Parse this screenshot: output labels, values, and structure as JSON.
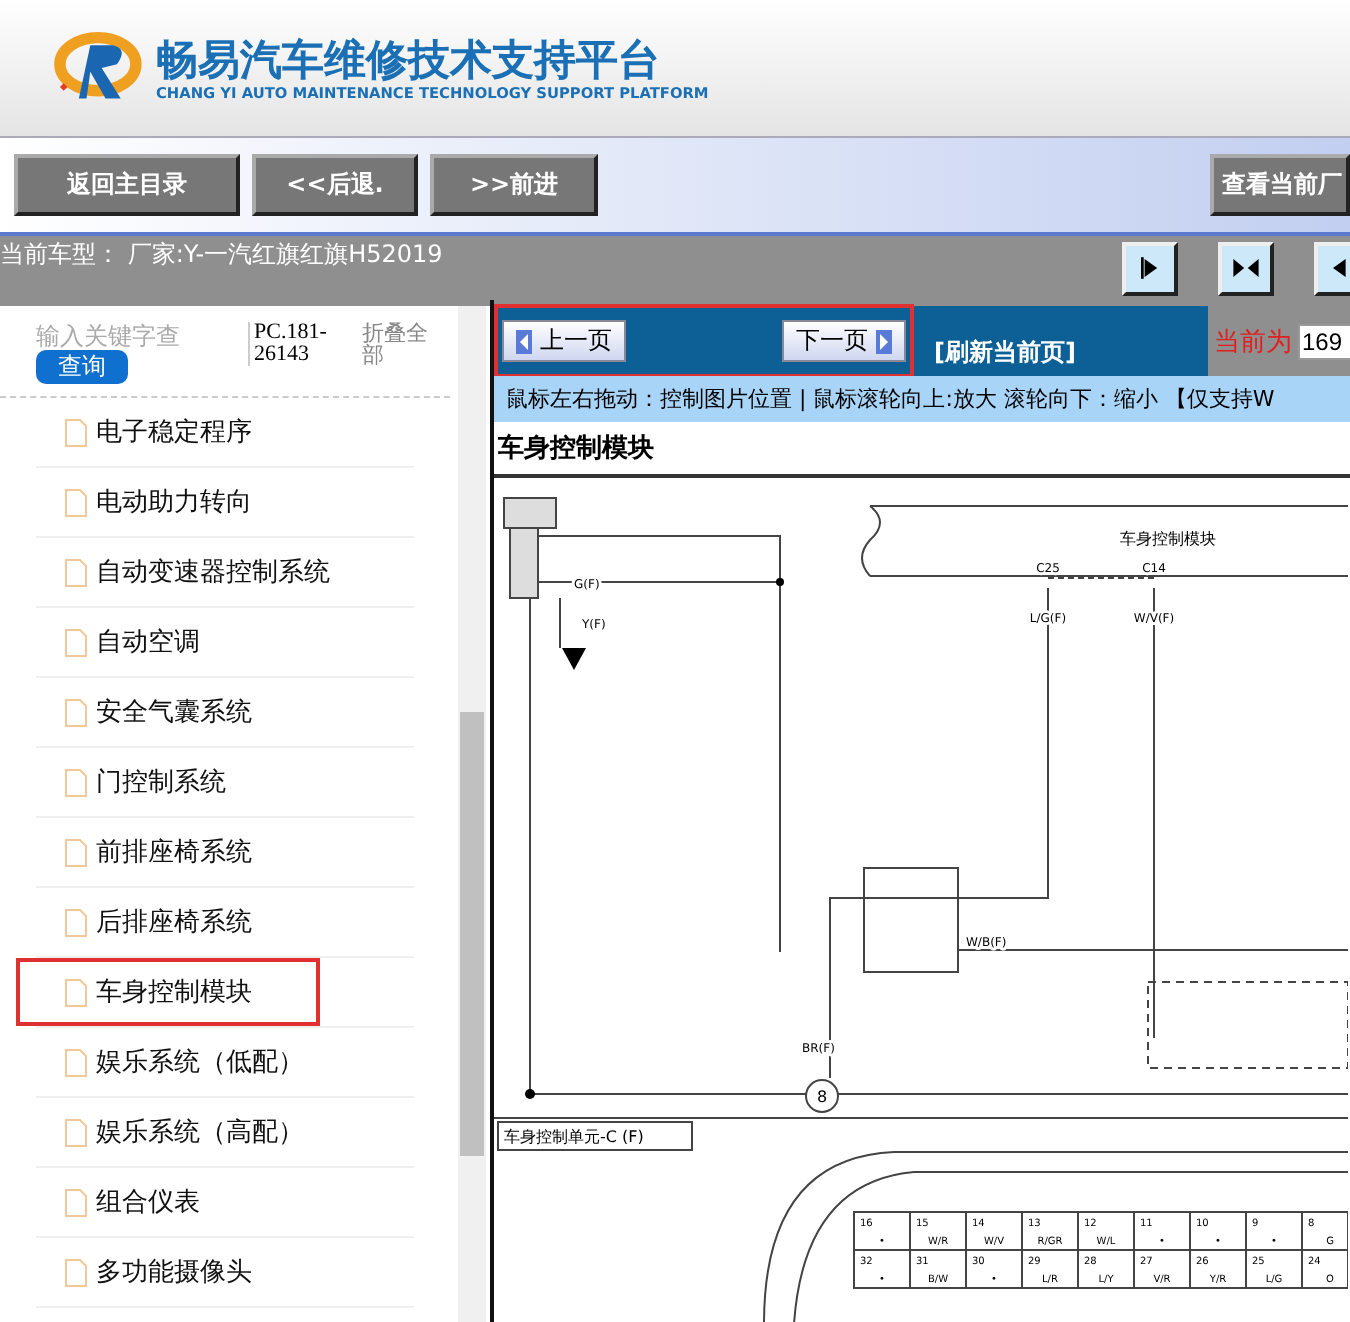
{
  "header": {
    "title": "畅易汽车维修技术支持平台",
    "subtitle": "CHANG YI AUTO MAINTENANCE TECHNOLOGY SUPPORT PLATFORM"
  },
  "toolbar": {
    "buttons": [
      "返回主目录",
      "<<后退.",
      ">>前进"
    ],
    "right_button": "查看当前厂"
  },
  "model_bar": {
    "text": "当前车型： 厂家:Y-一汽红旗红旗H52019"
  },
  "sidebar": {
    "search": {
      "placeholder": "输入关键字查"
    },
    "search_button": "查询",
    "code": "PC.181-26143",
    "collapse": "折叠全部",
    "items": [
      {
        "label": "电子稳定程序",
        "highlighted": false
      },
      {
        "label": "电动助力转向",
        "highlighted": false
      },
      {
        "label": "自动变速器控制系统",
        "highlighted": false
      },
      {
        "label": "自动空调",
        "highlighted": false
      },
      {
        "label": "安全气囊系统",
        "highlighted": false
      },
      {
        "label": "门控制系统",
        "highlighted": false
      },
      {
        "label": "前排座椅系统",
        "highlighted": false
      },
      {
        "label": "后排座椅系统",
        "highlighted": false
      },
      {
        "label": "车身控制模块",
        "highlighted": true
      },
      {
        "label": "娱乐系统（低配）",
        "highlighted": false
      },
      {
        "label": "娱乐系统（高配）",
        "highlighted": false
      },
      {
        "label": "组合仪表",
        "highlighted": false
      },
      {
        "label": "多功能摄像头",
        "highlighted": false
      }
    ]
  },
  "pager": {
    "prev": "上一页",
    "next": "下一页",
    "highlighted": true,
    "refresh": "[刷新当前页]",
    "current_label": "当前为",
    "current_value": "169"
  },
  "hint": "鼠标左右拖动：控制图片位置 | 鼠标滚轮向上:放大  滚轮向下：缩小 【仅支持W",
  "page_title": "车身控制模块",
  "diagram": {
    "module": "车身控制模块",
    "connector_a": "C25",
    "connector_b": "C14",
    "wire_a": "L/G(F)",
    "wire_b": "W/V(F)",
    "wire_g": "G(F)",
    "wire_y": "Y(F)",
    "wire_br": "BR(F)",
    "wire_wb": "W/B(F)",
    "ground_point": "8",
    "unit_label": "车身控制单元-C (F)",
    "pins": [
      [
        {
          "pin": "16",
          "wire": "•"
        },
        {
          "pin": "15",
          "wire": "W/R"
        },
        {
          "pin": "14",
          "wire": "W/V"
        },
        {
          "pin": "13",
          "wire": "R/GR"
        },
        {
          "pin": "12",
          "wire": "W/L"
        },
        {
          "pin": "11",
          "wire": "•"
        },
        {
          "pin": "10",
          "wire": "•"
        },
        {
          "pin": "9",
          "wire": "•"
        },
        {
          "pin": "8",
          "wire": "G"
        }
      ],
      [
        {
          "pin": "32",
          "wire": "•"
        },
        {
          "pin": "31",
          "wire": "B/W"
        },
        {
          "pin": "30",
          "wire": "•"
        },
        {
          "pin": "29",
          "wire": "L/R"
        },
        {
          "pin": "28",
          "wire": "L/Y"
        },
        {
          "pin": "27",
          "wire": "V/R"
        },
        {
          "pin": "26",
          "wire": "Y/R"
        },
        {
          "pin": "25",
          "wire": "L/G"
        },
        {
          "pin": "24",
          "wire": "O"
        }
      ]
    ]
  }
}
